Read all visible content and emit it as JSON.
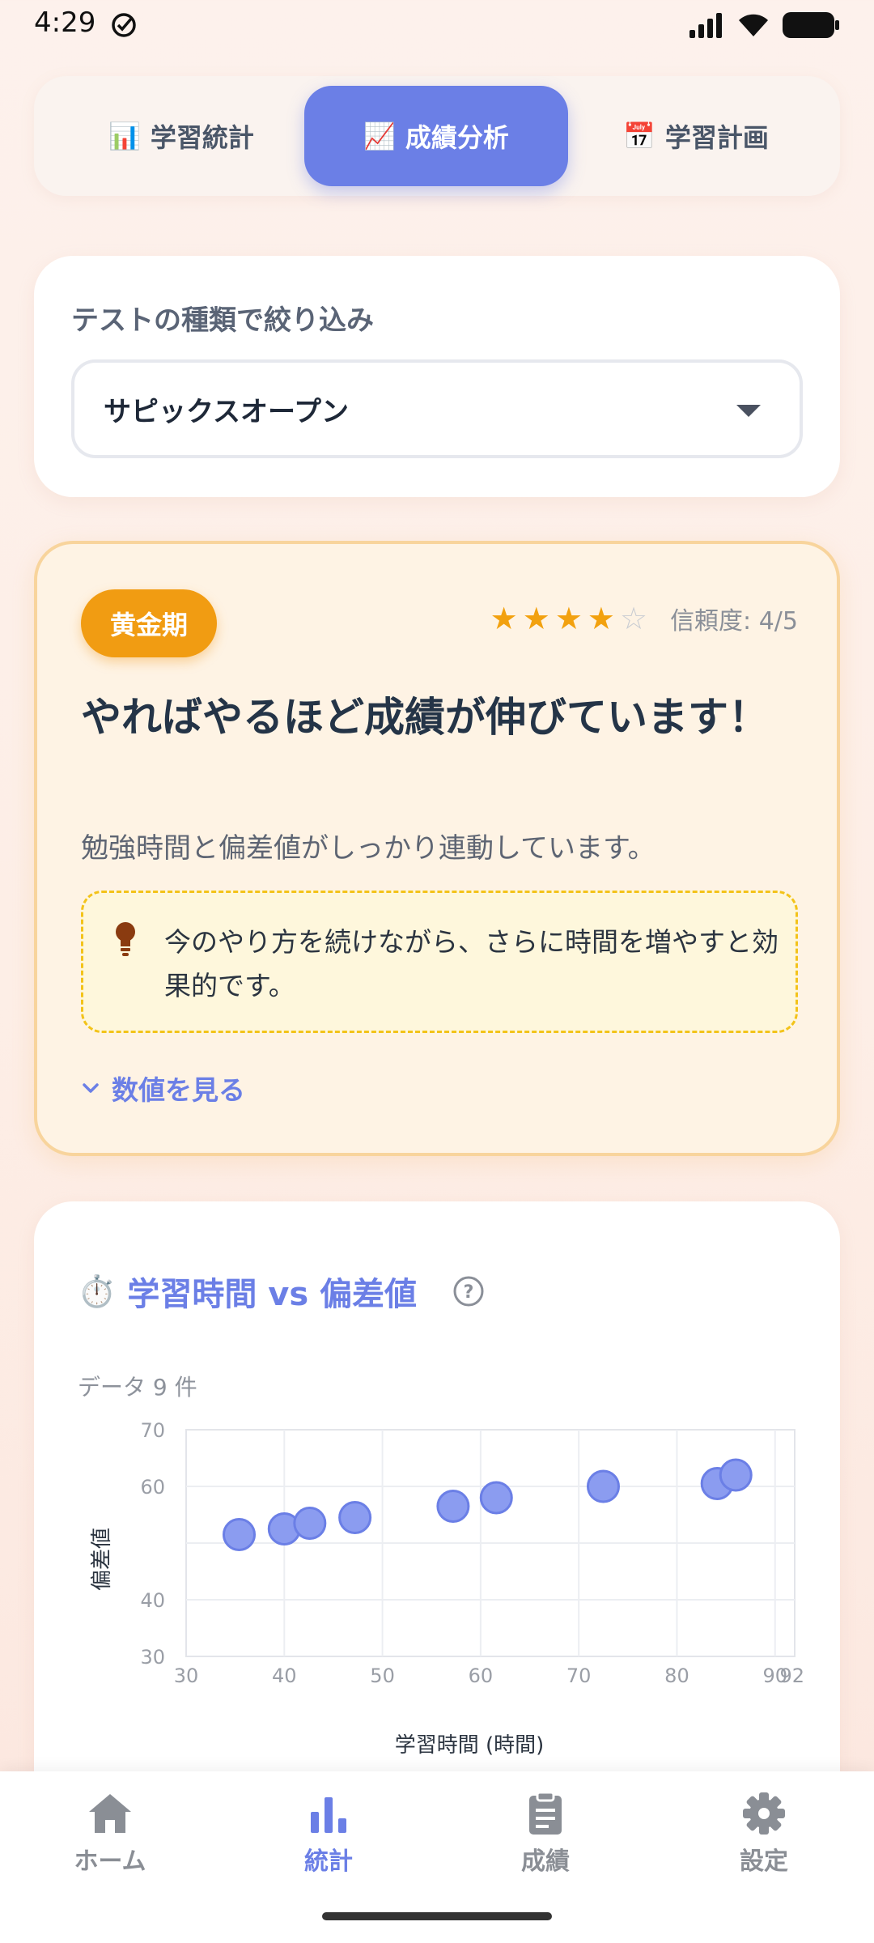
{
  "status": {
    "time": "4:29"
  },
  "tabs": [
    {
      "emoji": "📊",
      "label": "学習統計",
      "active": false
    },
    {
      "emoji": "📈",
      "label": "成績分析",
      "active": true
    },
    {
      "emoji": "📅",
      "label": "学習計画",
      "active": false
    }
  ],
  "filter": {
    "label": "テストの種類で絞り込み",
    "selected": "サピックスオープン"
  },
  "insight": {
    "badge": "黄金期",
    "rating": 4,
    "rating_max": 5,
    "confidence": "信頼度: 4/5",
    "title": "やればやるほど成績が伸びています！",
    "description": "勉強時間と偏差値がしっかり連動しています。",
    "tip": "今のやり方を続けながら、さらに時間を増やすと効果的です。",
    "toggle_label": "数値を見る",
    "colors": {
      "badge": "#f19c12",
      "accent": "#6b7fe6"
    }
  },
  "chart_card": {
    "emoji": "⏱️",
    "title": "学習時間 vs 偏差値",
    "data_count": "データ 9 件"
  },
  "chart_data": {
    "type": "scatter",
    "title": "学習時間 vs 偏差値",
    "xlabel": "学習時間 (時間)",
    "ylabel": "偏差値",
    "xlim": [
      30,
      92
    ],
    "ylim": [
      30,
      70
    ],
    "x_ticks": [
      30,
      40,
      50,
      60,
      70,
      80,
      90,
      92
    ],
    "y_ticks": [
      30,
      40,
      60,
      70
    ],
    "grid": true,
    "points": [
      {
        "x": 35.4,
        "y": 51.5
      },
      {
        "x": 40.0,
        "y": 52.5
      },
      {
        "x": 42.6,
        "y": 53.5
      },
      {
        "x": 47.2,
        "y": 54.5
      },
      {
        "x": 57.2,
        "y": 56.5
      },
      {
        "x": 61.6,
        "y": 58.0
      },
      {
        "x": 72.5,
        "y": 60.0
      },
      {
        "x": 84.1,
        "y": 60.5
      },
      {
        "x": 86.0,
        "y": 62.0
      }
    ],
    "color": "#8b9cf0"
  },
  "bottom_nav": [
    {
      "icon": "home-icon",
      "label": "ホーム",
      "active": false
    },
    {
      "icon": "bar-chart-icon",
      "label": "統計",
      "active": true
    },
    {
      "icon": "clipboard-icon",
      "label": "成績",
      "active": false
    },
    {
      "icon": "gear-icon",
      "label": "設定",
      "active": false
    }
  ]
}
